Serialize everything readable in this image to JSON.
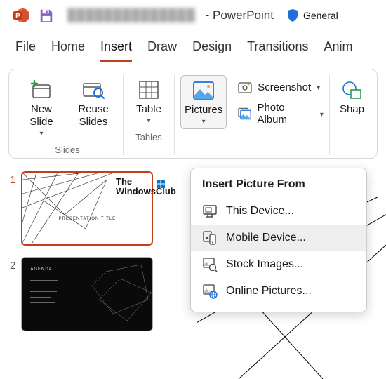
{
  "title": {
    "doc": "██████████████",
    "app": "- PowerPoint",
    "sensitivity": "General"
  },
  "tabs": [
    "File",
    "Home",
    "Insert",
    "Draw",
    "Design",
    "Transitions",
    "Anim"
  ],
  "activeTab": "Insert",
  "ribbon": {
    "slides": {
      "new": "New\nSlide",
      "reuse": "Reuse\nSlides",
      "group": "Slides"
    },
    "tables": {
      "table": "Table",
      "group": "Tables"
    },
    "pictures": {
      "btn": "Pictures",
      "screenshot": "Screenshot",
      "album": "Photo Album"
    },
    "shapes": {
      "btn": "Shap"
    }
  },
  "menu": {
    "header": "Insert Picture From",
    "items": [
      "This Device...",
      "Mobile Device...",
      "Stock Images...",
      "Online Pictures..."
    ]
  },
  "thumbs": {
    "n1": "1",
    "n2": "2",
    "t1": "PRESENTATION TITLE",
    "t2": "AGENDA"
  },
  "watermark": {
    "l1": "The",
    "l2": "WindowsClub"
  }
}
